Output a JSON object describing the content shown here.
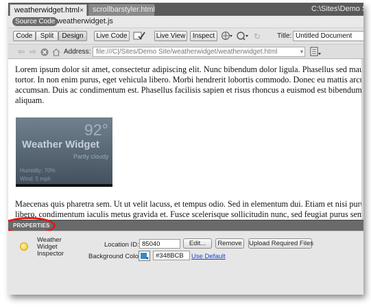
{
  "tabs": [
    {
      "label": "weatherwidget.html",
      "close": "×"
    },
    {
      "label": "scrollbarstyler.html",
      "close": "×"
    }
  ],
  "filepath": "C:\\Sites\\Demo Site\\weatherwidget.html",
  "related_files": {
    "source_code": "Source Code",
    "file": "weatherwidget.js"
  },
  "doc_toolbar": {
    "code": "Code",
    "split": "Split",
    "design": "Design",
    "live_code": "Live Code",
    "live_view": "Live View",
    "inspect": "Inspect",
    "title_label": "Title:",
    "title_value": "Untitled Document"
  },
  "browser_nav": {
    "address_label": "Address:",
    "address_value": "file:///C|/Sites/Demo Site/weatherwidget/weatherwidget.html"
  },
  "design": {
    "para1": [
      "Lorem ipsum dolor sit amet, consectetur adipiscing elit. Nunc bibendum dolor ligula. Phasellus sed mauris sed",
      "tortor. In non enim purus, eget vehicula libero. Morbi hendrerit lobortis commodo. Donec eu mattis arcu. Duis",
      "accumsan. Duis ac condimentum est. Phasellus facilisis sapien et risus rhoncus a euismod est bibendum. Suspen",
      "aliquam."
    ],
    "para2": [
      "Maecenas quis pharetra sem. Ut ut velit lacuss, et tempus odio. Sed in elementum dui. Etiam et nisi purus. Se",
      "libero, condimentum iaculis metus gravida et. Fusce scelerisque sollicitudin nunc, sed feugiat purus semper a"
    ],
    "widget": {
      "title": "Weather Widget",
      "temp": "92°",
      "condition": "Partly cloudy",
      "line1": "Humidity: 70%",
      "line2": "Wind: 5 mph"
    }
  },
  "properties": {
    "title": "PROPERTIES",
    "inspector_name": "Weather Widget Inspector",
    "location_label": "Location ID:",
    "location_value": "85040",
    "edit_button": "Edit...",
    "remove_button": "Remove",
    "upload_button": "Upload Required Files",
    "bg_label": "Background Color:",
    "bg_color": "#348BCB",
    "use_default": "Use Default"
  },
  "colors": {
    "annotation": "#e01818",
    "swatch": "#348BCB",
    "link": "#1a3fc9"
  }
}
